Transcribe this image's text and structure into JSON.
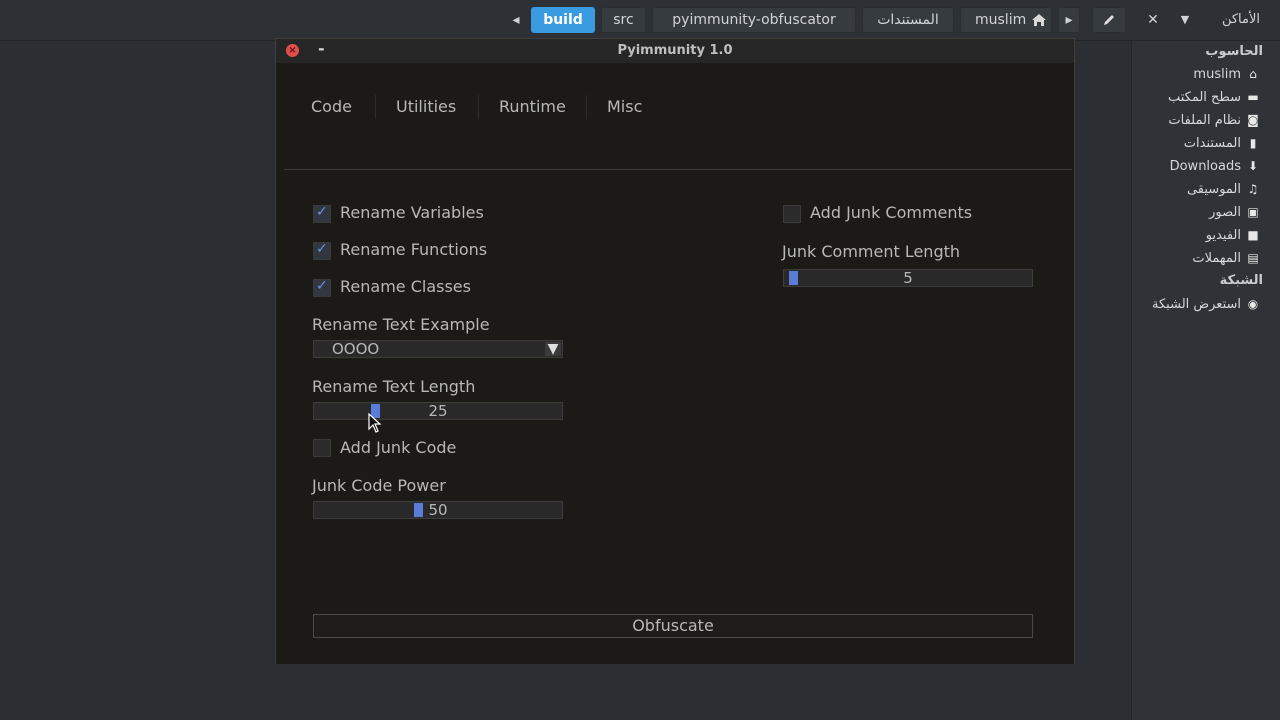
{
  "header": {
    "breadcrumbs": [
      "build",
      "src",
      "pyimmunity-obfuscator",
      "المستندات",
      "muslim"
    ],
    "places_label": "الأماكن"
  },
  "sidebar": {
    "section_computer": "الحاسوب",
    "section_network": "الشبكة",
    "items": [
      {
        "label": "muslim",
        "icon": "home-icon"
      },
      {
        "label": "سطح المكتب",
        "icon": "desktop-icon"
      },
      {
        "label": "نظام الملفات",
        "icon": "drive-icon"
      },
      {
        "label": "المستندات",
        "icon": "document-icon"
      },
      {
        "label": "Downloads",
        "icon": "download-icon"
      },
      {
        "label": "الموسيقى",
        "icon": "music-icon"
      },
      {
        "label": "الصور",
        "icon": "image-icon"
      },
      {
        "label": "الفيديو",
        "icon": "video-icon"
      },
      {
        "label": "المهملات",
        "icon": "trash-icon"
      }
    ],
    "network_items": [
      {
        "label": "استعرض الشبكة",
        "icon": "globe-icon"
      }
    ]
  },
  "app": {
    "title": "Pyimmunity 1.0",
    "tabs": [
      "Code",
      "Utilities",
      "Runtime",
      "Misc"
    ],
    "options": {
      "rename_variables": {
        "label": "Rename Variables",
        "checked": true
      },
      "rename_functions": {
        "label": "Rename Functions",
        "checked": true
      },
      "rename_classes": {
        "label": "Rename Classes",
        "checked": true
      },
      "add_junk_code": {
        "label": "Add Junk Code",
        "checked": false
      },
      "add_junk_comments": {
        "label": "Add Junk Comments",
        "checked": false
      }
    },
    "rename_text_example": {
      "label": "Rename Text Example",
      "value": "OOOO"
    },
    "rename_text_length": {
      "label": "Rename Text Length",
      "value": "25",
      "fraction": 0.24
    },
    "junk_code_power": {
      "label": "Junk Code Power",
      "value": "50",
      "fraction": 0.42
    },
    "junk_comment_length": {
      "label": "Junk Comment Length",
      "value": "5",
      "fraction": 0.02
    },
    "obfuscate_label": "Obfuscate"
  },
  "colors": {
    "accent": "#3a9be0",
    "slider_grab": "#5a7cd8",
    "close": "#e0504a"
  }
}
